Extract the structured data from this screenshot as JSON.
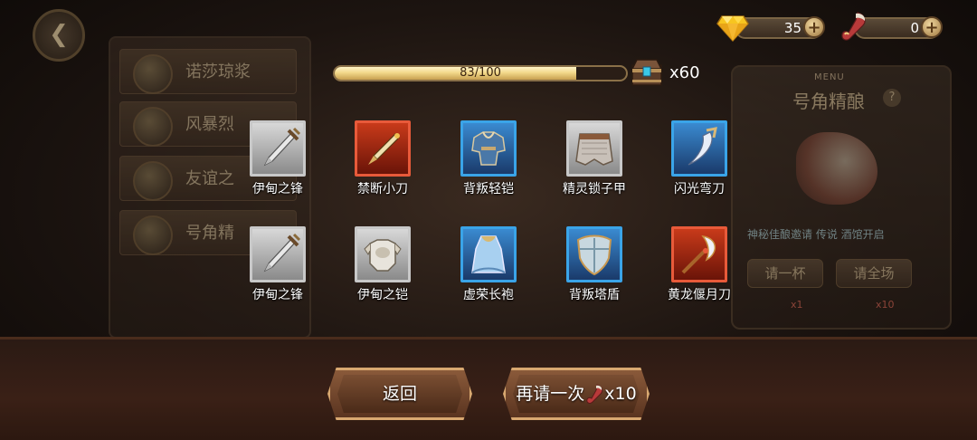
{
  "background": {
    "left_menu": [
      "诺莎琼浆",
      "风暴烈",
      "友谊之",
      "号角精"
    ],
    "right_panel": {
      "menu_label": "MENU",
      "title": "号角精酿",
      "tagline": "神秘佳酿邀请 传说 酒馆开启",
      "buttons": [
        "请一杯",
        "请全场"
      ],
      "costs": [
        "x1",
        "x10"
      ]
    }
  },
  "resources": {
    "gems": "35",
    "horns": "0"
  },
  "progress": {
    "text": "83/100",
    "current": 83,
    "max": 100
  },
  "chest": {
    "count": "x60"
  },
  "items": [
    {
      "name": "伊甸之锋",
      "rarity": "gray",
      "icon": "sword-icon"
    },
    {
      "name": "禁断小刀",
      "rarity": "red",
      "icon": "dagger-icon"
    },
    {
      "name": "背叛轻铠",
      "rarity": "blue",
      "icon": "light-armor-icon"
    },
    {
      "name": "精灵锁子甲",
      "rarity": "gray",
      "icon": "chainmail-icon"
    },
    {
      "name": "闪光弯刀",
      "rarity": "blue",
      "icon": "scimitar-icon"
    },
    {
      "name": "伊甸之锋",
      "rarity": "gray",
      "icon": "sword-icon"
    },
    {
      "name": "伊甸之铠",
      "rarity": "gray",
      "icon": "armor-icon"
    },
    {
      "name": "虚荣长袍",
      "rarity": "blue",
      "icon": "robe-icon"
    },
    {
      "name": "背叛塔盾",
      "rarity": "blue",
      "icon": "shield-icon"
    },
    {
      "name": "黄龙偃月刀",
      "rarity": "red",
      "icon": "glaive-icon"
    }
  ],
  "buttons": {
    "back": "返回",
    "again": "再请一次",
    "again_cost": "x10"
  }
}
